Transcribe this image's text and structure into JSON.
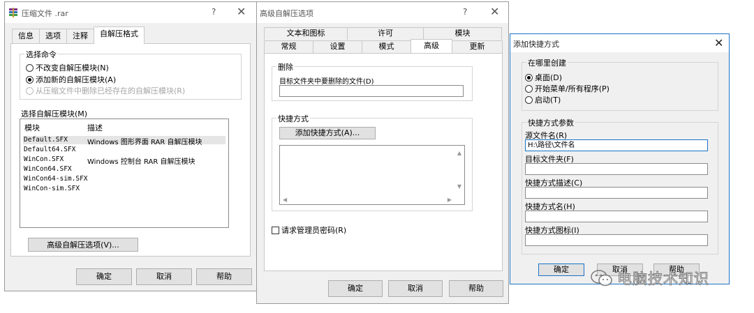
{
  "left_dialog": {
    "title": "压缩文件 .rar",
    "help": "?",
    "close": "✕",
    "tabs": [
      "信息",
      "选项",
      "注释",
      "自解压格式"
    ],
    "group_command": "选择命令",
    "radio_options": [
      "不改变自解压模块(N)",
      "添加新的自解压模块(A)",
      "从压缩文件中删除已经存在的自解压模块(R)"
    ],
    "module_label": "选择自解压模块(M)",
    "columns": [
      "模块",
      "描述"
    ],
    "modules": [
      {
        "name": "Default.SFX",
        "desc": "Windows 图形界面 RAR 自解压模块"
      },
      {
        "name": "Default64.SFX",
        "desc": ""
      },
      {
        "name": "WinCon.SFX",
        "desc": "Windows 控制台 RAR 自解压模块"
      },
      {
        "name": "WinCon64.SFX",
        "desc": ""
      },
      {
        "name": "WinCon64-sim.SFX",
        "desc": ""
      },
      {
        "name": "WinCon-sim.SFX",
        "desc": ""
      }
    ],
    "advanced_button": "高级自解压选项(V)...",
    "ok": "确定",
    "cancel": "取消",
    "help_button": "帮助"
  },
  "middle_dialog": {
    "title": "高级自解压选项",
    "help": "?",
    "close": "✕",
    "tabs_row1": [
      "文本和图标",
      "许可",
      "模块"
    ],
    "tabs_row2": [
      "常规",
      "设置",
      "模式",
      "高级",
      "更新"
    ],
    "group_delete": "删除",
    "delete_label": "目标文件夹中要删除的文件(D)",
    "delete_value": "",
    "group_shortcut": "快捷方式",
    "add_shortcut_button": "添加快捷方式(A)...",
    "admin_checkbox": "请求管理员密码(R)",
    "ok": "确定",
    "cancel": "取消",
    "help_button": "帮助"
  },
  "right_dialog": {
    "title": "添加快捷方式",
    "close": "✕",
    "group_where": "在哪里创建",
    "where_options": [
      "桌面(D)",
      "开始菜单/所有程序(P)",
      "启动(T)"
    ],
    "group_params": "快捷方式参数",
    "source_label": "源文件名(R)",
    "source_value": "H:\\路径\\文件名",
    "dest_label": "目标文件夹(F)",
    "dest_value": "",
    "desc_label": "快捷方式描述(C)",
    "desc_value": "",
    "name_label": "快捷方式名(H)",
    "name_value": "",
    "icon_label": "快捷方式图标(I)",
    "icon_value": "",
    "ok": "确定",
    "cancel": "取消",
    "help_button": "帮助"
  },
  "watermark": "电脑技术知识"
}
